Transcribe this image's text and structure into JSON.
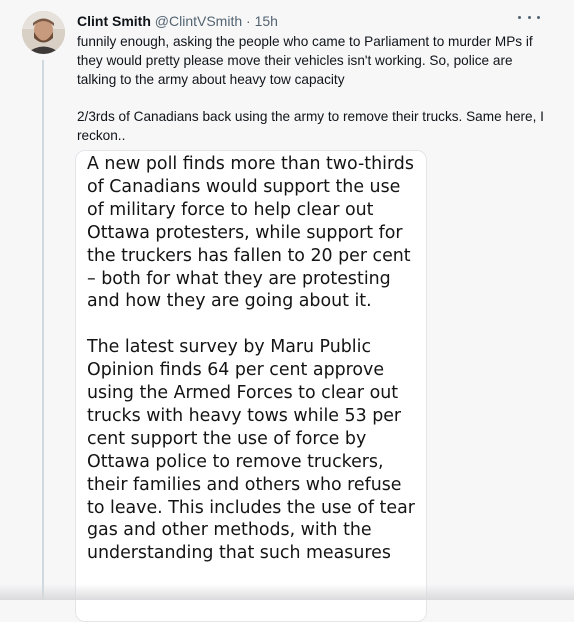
{
  "tweet": {
    "display_name": "Clint Smith",
    "handle": "@ClintVSmith",
    "separator": "·",
    "time": "15h",
    "paragraphs": [
      "funnily enough, asking the people who came to Parliament to murder MPs if they would pretty please move their vehicles isn't working. So, police are talking to the army about heavy tow capacity",
      "2/3rds of Canadians back using the army to remove their trucks. Same here, I reckon.."
    ]
  },
  "quote": {
    "paragraphs": [
      "A new poll finds more than two-thirds of Canadians would support the use of military force to help clear out Ottawa protesters, while support for the truckers has fallen to 20 per cent – both for what they are protesting and how they are going about it.",
      "The latest survey by Maru Public Opinion finds 64 per cent approve using the Armed Forces to clear out trucks with heavy tows while 53 per cent support the use of force by Ottawa police to remove truckers, their families and others who refuse to leave. This includes the use of tear gas and other methods, with the understanding that such measures"
    ]
  },
  "icons": {
    "more": "more-horizontal-icon",
    "avatar": "user-avatar-photo"
  }
}
